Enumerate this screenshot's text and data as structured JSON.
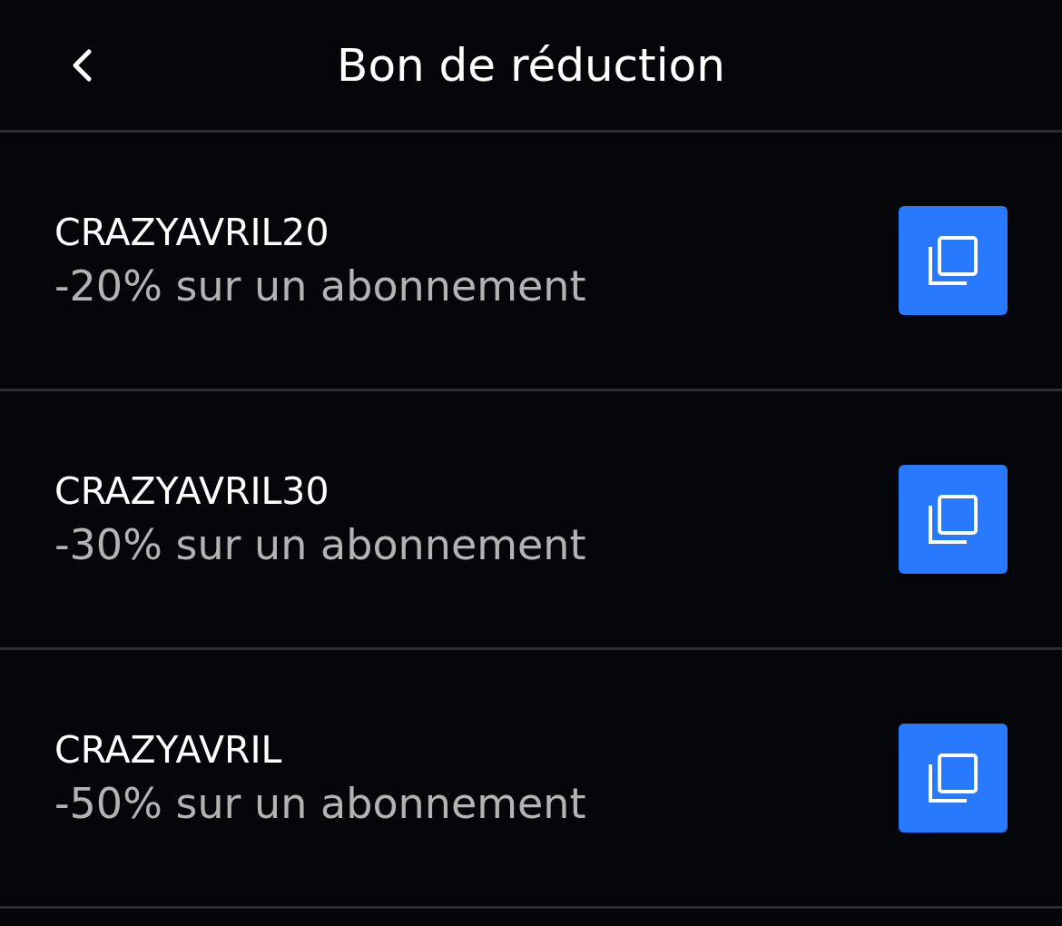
{
  "header": {
    "title": "Bon de réduction"
  },
  "coupons": [
    {
      "code": "CRAZYAVRIL20",
      "description": "-20% sur un abonnement"
    },
    {
      "code": "CRAZYAVRIL30",
      "description": "-30% sur un abonnement"
    },
    {
      "code": "CRAZYAVRIL",
      "description": "-50% sur un abonnement"
    }
  ]
}
